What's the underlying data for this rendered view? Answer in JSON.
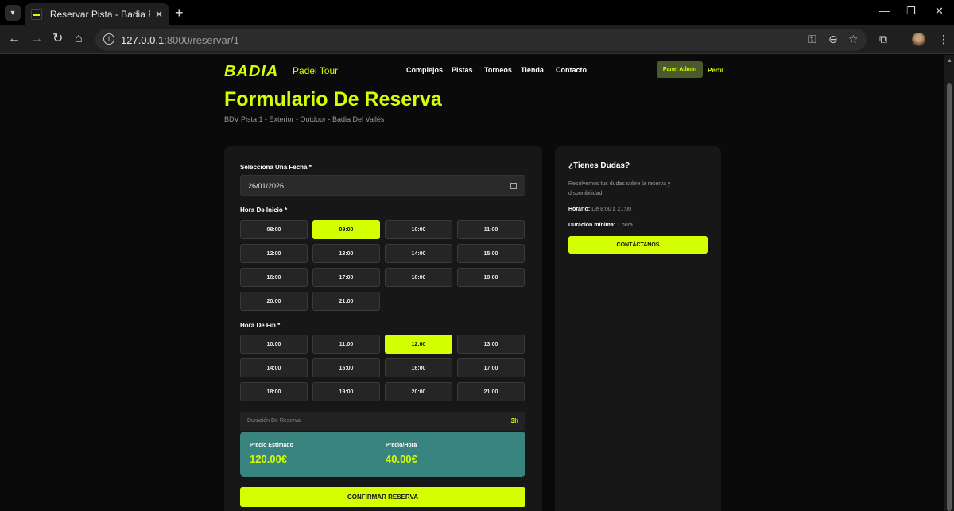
{
  "browser": {
    "tab_title": "Reservar Pista - Badia Padel Tour",
    "url_host": "127.0.0.1",
    "url_rest": ":8000/reservar/1",
    "icons": [
      "tab-search-icon",
      "favicon",
      "close-icon",
      "new-tab-icon",
      "minimize-icon",
      "restore-icon",
      "close-window-icon",
      "back-icon",
      "forward-icon",
      "reload-icon",
      "home-icon",
      "site-info-icon",
      "password-key-icon",
      "zoom-icon",
      "bookmark-star-icon",
      "extensions-icon",
      "profile-avatar",
      "more-menu-icon"
    ]
  },
  "nav": {
    "logo": "BADIA",
    "logo_sub": "Padel Tour",
    "links": [
      "Complejos",
      "Pistas",
      "Torneos",
      "Tienda",
      "Contacto"
    ],
    "admin": "Panel Admin",
    "perfil": "Perfil"
  },
  "page": {
    "title": "Formulario De Reserva",
    "subtitle": "BDV Pista 1 - Exterior - Outdoor - Badia Del Vallés"
  },
  "form": {
    "date_label": "Selecciona Una Fecha *",
    "date_value": "26/01/2026",
    "start_label": "Hora De Inicio *",
    "start_slots": [
      "08:00",
      "09:00",
      "10:00",
      "11:00",
      "12:00",
      "13:00",
      "14:00",
      "15:00",
      "16:00",
      "17:00",
      "18:00",
      "19:00",
      "20:00",
      "21:00"
    ],
    "start_selected": "09:00",
    "end_label": "Hora De Fin *",
    "end_slots": [
      "10:00",
      "11:00",
      "12:00",
      "13:00",
      "14:00",
      "15:00",
      "16:00",
      "17:00",
      "18:00",
      "19:00",
      "20:00",
      "21:00"
    ],
    "end_selected": "12:00",
    "duration_label": "Duración De Reserva",
    "duration_value": "3h",
    "price_est_label": "Precio Estimado",
    "price_est_value": "120.00€",
    "price_hour_label": "Precio/Hora",
    "price_hour_value": "40.00€",
    "confirm": "CONFIRMAR RESERVA"
  },
  "sidebar": {
    "title": "¿Tienes Dudas?",
    "text": "Resolvemos tus dudas sobre la reserva y disponibilidad.",
    "horario_label": "Horario:",
    "horario_value": "De 8:00 a 21:00",
    "duracion_label": "Duración mínima:",
    "duracion_value": "1 hora",
    "contact": "CONTÁCTANOS"
  },
  "colors": {
    "accent": "#d4ff00",
    "price_box": "#3a8480",
    "card": "#171717",
    "background": "#0a0a0a"
  }
}
